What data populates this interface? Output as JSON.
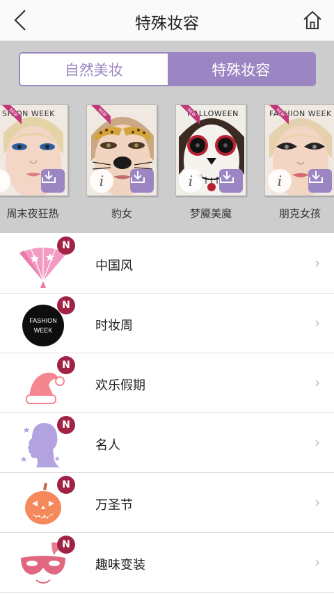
{
  "header": {
    "title": "特殊妆容",
    "back_icon": "chevron-left-icon",
    "home_icon": "home-icon"
  },
  "tabs": [
    {
      "label": "自然美妆",
      "active": false
    },
    {
      "label": "特殊妆容",
      "active": true
    }
  ],
  "looks": [
    {
      "name": "周末夜狂热",
      "banner": "SHION WEEK",
      "new": true
    },
    {
      "name": "豹女",
      "banner": "",
      "new": true
    },
    {
      "name": "梦魇美魔",
      "banner": "HALLOWEEN",
      "new": true
    },
    {
      "name": "朋克女孩",
      "banner": "FASHION WEEK",
      "new": true
    }
  ],
  "new_ribbon_text": "NEW",
  "info_glyph": "i",
  "badge_text": "N",
  "categories": [
    {
      "label": "中国风",
      "icon": "folding-fan-icon"
    },
    {
      "label": "时妆周",
      "icon": "fashion-week-icon",
      "icon_text_1": "FASHION",
      "icon_text_2": "WEEK"
    },
    {
      "label": "欢乐假期",
      "icon": "santa-hat-icon"
    },
    {
      "label": "名人",
      "icon": "profile-silhouette-icon"
    },
    {
      "label": "万圣节",
      "icon": "pumpkin-icon"
    },
    {
      "label": "趣味变装",
      "icon": "masquerade-mask-icon"
    }
  ],
  "colors": {
    "accent": "#9b86c3",
    "badge": "#a02346",
    "gray_bg": "#cdcdcd"
  }
}
